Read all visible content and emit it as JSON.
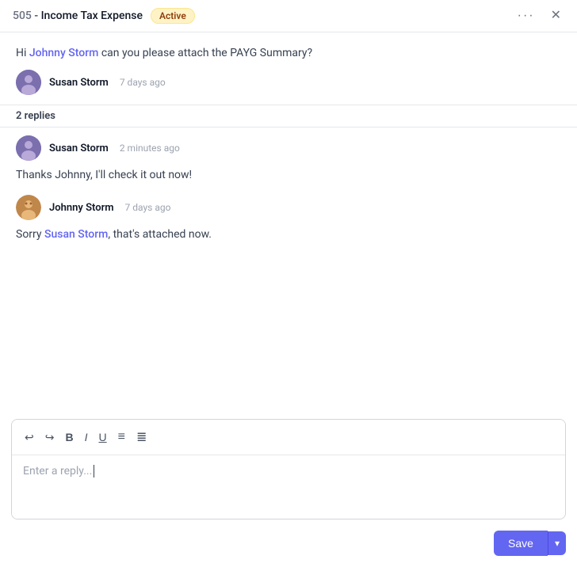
{
  "header": {
    "account_code": "505",
    "separator": " - ",
    "account_name": "Income Tax Expense",
    "badge_label": "Active",
    "more_icon": "•••",
    "close_icon": "✕"
  },
  "main_post": {
    "text_before": "Hi ",
    "mention": "Johnny Storm",
    "text_after": " can you please attach the PAYG Summary?",
    "author": "Susan Storm",
    "timestamp": "7 days ago"
  },
  "replies_label": "2 replies",
  "replies": [
    {
      "author": "Susan Storm",
      "timestamp": "2 minutes ago",
      "body": "Thanks Johnny, I'll check it out now!",
      "avatar_type": "susan"
    },
    {
      "author": "Johnny Storm",
      "timestamp": "7 days ago",
      "body_before": "Sorry ",
      "mention": "Susan Storm",
      "body_after": ", that's attached now.",
      "avatar_type": "johnny"
    }
  ],
  "editor": {
    "placeholder": "Enter a reply...",
    "toolbar": {
      "undo": "↩",
      "redo": "↪",
      "bold": "B",
      "italic": "I",
      "underline": "U",
      "bullet_list": "≡",
      "ordered_list": "≣"
    }
  },
  "actions": {
    "save_label": "Save",
    "dropdown_icon": "▾"
  }
}
